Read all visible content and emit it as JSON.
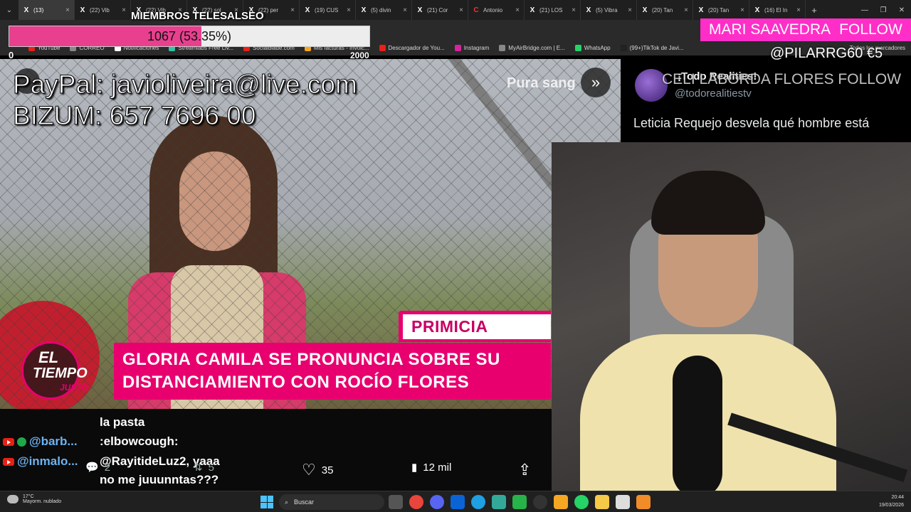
{
  "browser": {
    "tabs": [
      {
        "label": "(13)",
        "icon": "x-logo-icon",
        "active": true
      },
      {
        "label": "(22) Vib",
        "icon": "x-logo-icon"
      },
      {
        "label": "(22) Vib",
        "icon": "x-logo-icon"
      },
      {
        "label": "(22) sol",
        "icon": "x-logo-icon"
      },
      {
        "label": "(22) per",
        "icon": "x-logo-icon"
      },
      {
        "label": "(19) CUS",
        "icon": "x-logo-icon"
      },
      {
        "label": "(5) divin",
        "icon": "x-logo-icon"
      },
      {
        "label": "(21) Cor",
        "icon": "x-logo-icon"
      },
      {
        "label": "Antonio",
        "icon": "c-logo-icon"
      },
      {
        "label": "(21) LOS",
        "icon": "x-logo-icon"
      },
      {
        "label": "(5) Vibra",
        "icon": "x-logo-icon"
      },
      {
        "label": "(20) Tan",
        "icon": "x-logo-icon"
      },
      {
        "label": "(20) Tan",
        "icon": "x-logo-icon"
      },
      {
        "label": "(16) El In",
        "icon": "x-logo-icon"
      }
    ],
    "close_glyph": "×",
    "newtab_glyph": "+",
    "bookmarks": [
      {
        "label": "YouTube",
        "color": "#e62117"
      },
      {
        "label": "CORREO",
        "color": "#888888"
      },
      {
        "label": "Notificaciones",
        "color": "#ffffff"
      },
      {
        "label": "Streamlabs Free Liv...",
        "color": "#31c3a2"
      },
      {
        "label": "Socialblade.com",
        "color": "#e62117"
      },
      {
        "label": "Mis facturas - Invoic...",
        "color": "#f5a623"
      },
      {
        "label": "Descargador de You...",
        "color": "#e62117"
      },
      {
        "label": "Instagram",
        "color": "#d6249f"
      },
      {
        "label": "MyAirBridge.com | E...",
        "color": "#888888"
      },
      {
        "label": "WhatsApp",
        "color": "#25d366"
      },
      {
        "label": "(99+)TikTok de Javi...",
        "color": "#222222"
      }
    ],
    "bookmarks_all": "Todos los marcadores"
  },
  "goal": {
    "title": "MIEMBROS TELESALSEO",
    "text": "1067 (53.35%)",
    "progress_fraction": 0.5335,
    "min": "0",
    "max": "2000",
    "fill_color": "#e8408f"
  },
  "alerts": {
    "follow_name": "MARI SAAVEDRA",
    "follow_word": "FOLLOW",
    "donation": "@PILARRG60  €5",
    "follow_overlay": "CELI LABORDA FLORES  FOLLOW"
  },
  "donation_info": {
    "paypal": "PayPal: javioliveira@live.com",
    "bizum": "BIZUM: 657 7696 00"
  },
  "video": {
    "badge": "PRIMICIA",
    "headline_line1": "GLORIA CAMILA SE PRONUNCIA SOBRE SU",
    "headline_line2": "DISTANCIAMIENTO CON ROCÍO FLORES",
    "logo_el": "EL",
    "logo_tiempo": "TIEMPO",
    "logo_justo": "JUSTO",
    "watermark": "Pura sang",
    "next_glyph": "»",
    "accent": "#e8006f"
  },
  "post": {
    "name": "¡Todo Realities!",
    "handle": "@todorealitiestv",
    "text": "Leticia Requejo desvela qué hombre está"
  },
  "chat": {
    "line_top": "la pasta",
    "line1": ":elbowcough:",
    "line2": "@RayitideLuz2, yaaa",
    "line3": "no me juuunntas???",
    "user1": "@barb...",
    "user2": "@inmalo...",
    "reply_count": "2",
    "repost_count": "5"
  },
  "actions": {
    "likes": "35",
    "views": "12 mil"
  },
  "taskbar": {
    "weather_temp": "17°C",
    "weather_desc": "Mayorm. nublado",
    "search_placeholder": "Buscar",
    "time": "20:44",
    "date": "19/03/2026"
  }
}
